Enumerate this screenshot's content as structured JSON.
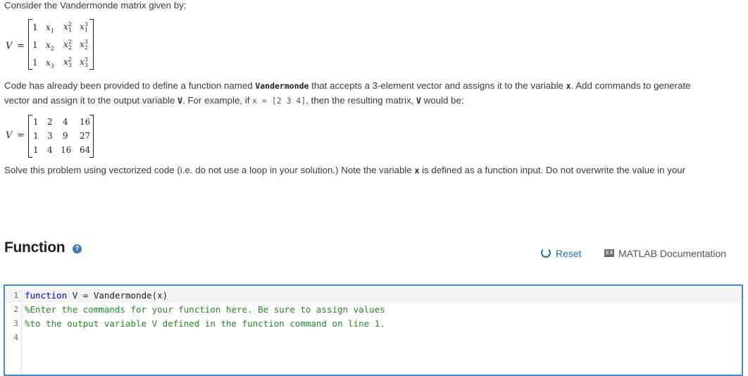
{
  "problem": {
    "intro": "Consider the Vandermonde matrix given by:",
    "matrix_symbol": "V",
    "equals": "=",
    "generic_matrix": [
      [
        "1",
        "x1",
        "x1^2",
        "x1^3"
      ],
      [
        "1",
        "x2",
        "x2^2",
        "x2^3"
      ],
      [
        "1",
        "x3",
        "x3^2",
        "x3^3"
      ]
    ],
    "para1_a": "Code has already been provided to define a function named ",
    "para1_fn": "Vandermonde",
    "para1_b": " that accepts a 3-element vector and assigns it to the variable ",
    "para1_x": "x",
    "para1_c": ". Add commands to generate",
    "para2_a": "vector and assign it to the output variable ",
    "para2_v": "V",
    "para2_b": ". For example, if ",
    "para2_code": "x = [2 3 4]",
    "para2_c": ", then the resulting matrix, ",
    "para2_v2": "V",
    "para2_d": " would be:",
    "example_matrix": [
      [
        "1",
        "2",
        "4",
        "16"
      ],
      [
        "1",
        "3",
        "9",
        "27"
      ],
      [
        "1",
        "4",
        "16",
        "64"
      ]
    ],
    "para3_a": "Solve this problem using vectorized code (i.e. do not use a loop in your solution.)  Note the variable ",
    "para3_x": "x",
    "para3_b": " is defined as a function input.  Do not overwrite the value in your"
  },
  "function_section": {
    "title": "Function",
    "help_icon": "question-circle-icon",
    "reset_label": "Reset",
    "doc_label": "MATLAB Documentation"
  },
  "editor": {
    "lines": [
      {
        "num": "1",
        "kw": "function",
        "text": " V = Vandermonde(x)"
      },
      {
        "num": "2",
        "comment": "%Enter the commands for your function here. Be sure to assign values"
      },
      {
        "num": "3",
        "comment": "%to the output variable V defined in the function command on line 1."
      },
      {
        "num": "4",
        "text": ""
      }
    ],
    "accent_color": "#3e8fd6"
  }
}
